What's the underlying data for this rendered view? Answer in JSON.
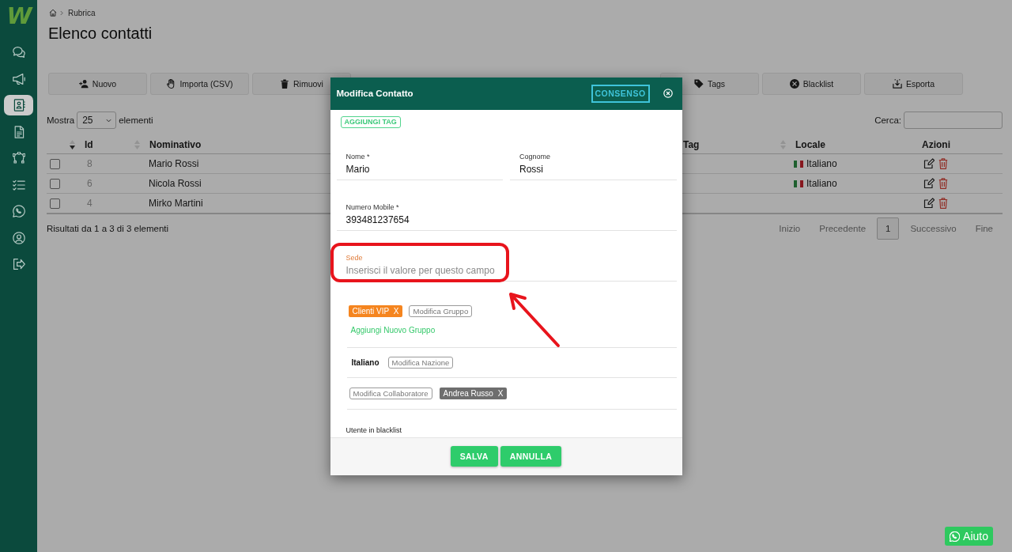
{
  "sidebar": {
    "logo": "W",
    "items": [
      {
        "selected": false
      },
      {
        "selected": false
      },
      {
        "selected": true
      },
      {
        "selected": false
      },
      {
        "selected": false
      },
      {
        "selected": false
      },
      {
        "selected": false
      },
      {
        "selected": false
      },
      {
        "selected": false
      }
    ]
  },
  "breadcrumb": {
    "current": "Rubrica"
  },
  "page_title": "Elenco contatti",
  "toolbar": {
    "left": [
      {
        "label": "Nuovo"
      },
      {
        "label": "Importa (CSV)"
      },
      {
        "label": "Rimuovi"
      }
    ],
    "right": [
      {
        "label": "Tags"
      },
      {
        "label": "Blacklist"
      },
      {
        "label": "Esporta"
      }
    ]
  },
  "length_menu": {
    "before": "Mostra",
    "value": "25",
    "after": "elementi"
  },
  "search": {
    "label": "Cerca:"
  },
  "table": {
    "columns": [
      {
        "label": "Id",
        "sortable": true,
        "sorted": true
      },
      {
        "label": "Nominativo",
        "sortable": true,
        "sorted": false
      },
      {
        "label": "Tag",
        "sortable": false
      },
      {
        "label": "Locale",
        "sortable": true,
        "sorted": false
      },
      {
        "label": "Azioni",
        "sortable": false
      }
    ],
    "rows": [
      {
        "checked": false,
        "id": "8",
        "name": "Mario Rossi",
        "locale": "Italiano"
      },
      {
        "checked": false,
        "id": "6",
        "name": "Nicola Rossi",
        "locale": "Italiano"
      },
      {
        "checked": false,
        "id": "4",
        "name": "Mirko Martini"
      }
    ]
  },
  "table_info": "Risultati da 1 a 3 di 3 elementi",
  "pagination": [
    {
      "label": "Inizio",
      "selected": false
    },
    {
      "label": "Precedente",
      "selected": false
    },
    {
      "label": "1",
      "selected": true
    },
    {
      "label": "Successivo",
      "selected": false
    },
    {
      "label": "Fine",
      "selected": false
    }
  ],
  "modal": {
    "title": "Modifica Contatto",
    "consent_button": "CONSENSO",
    "add_tag_button": "AGGIUNGI TAG",
    "field_rows": [
      [
        {
          "label": "Nome *",
          "value": "Mario",
          "focused": false,
          "highlighted": false
        },
        {
          "label": "Cognome",
          "value": "Rossi",
          "focused": false,
          "highlighted": false
        }
      ],
      [
        {
          "label": "Numero Mobile *",
          "value": "393481237654",
          "focused": false,
          "highlighted": false
        }
      ],
      [
        {
          "label": "Sede",
          "placeholder": "Inserisci il valore per questo campo",
          "focused": true,
          "highlighted": true
        }
      ]
    ],
    "groups": {
      "tags": [
        {
          "label": "Clienti VIP",
          "remove": "X"
        }
      ],
      "edit_button": "Modifica Gruppo",
      "add_link": "Aggiungi Nuovo Gruppo"
    },
    "country": {
      "value": "Italiano",
      "edit_button": "Modifica Nazione"
    },
    "collaborators": {
      "edit_button": "Modifica Collaboratore",
      "tags": [
        {
          "label": "Andrea Russo",
          "remove": "X"
        }
      ]
    },
    "blacklist_label": "Utente in blacklist",
    "buttons": [
      "SALVA",
      "ANNULLA"
    ]
  },
  "help_button": {
    "label": "Aiuto"
  }
}
